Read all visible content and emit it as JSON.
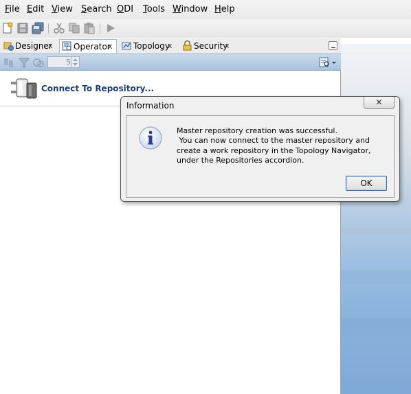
{
  "menu": {
    "items": [
      {
        "mnemonic": "F",
        "rest": "ile"
      },
      {
        "mnemonic": "E",
        "rest": "dit"
      },
      {
        "mnemonic": "V",
        "rest": "iew"
      },
      {
        "mnemonic": "S",
        "rest": "earch"
      },
      {
        "mnemonic": "O",
        "rest": "DI"
      },
      {
        "mnemonic": "T",
        "rest": "ools"
      },
      {
        "mnemonic": "W",
        "rest": "indow"
      },
      {
        "mnemonic": "H",
        "rest": "elp"
      }
    ]
  },
  "navigator_tabs": [
    {
      "label": "Designer",
      "icon": "designer-icon",
      "close": "x"
    },
    {
      "label": "Operator",
      "icon": "operator-icon",
      "close": "x",
      "active": true
    },
    {
      "label": "Topology",
      "icon": "topology-icon",
      "close": "x"
    },
    {
      "label": "Security",
      "icon": "security-icon",
      "close": "x"
    }
  ],
  "panel_toolbar": {
    "spinner_value": "5"
  },
  "panel": {
    "connect_label": "Connect To Repository..."
  },
  "dialog": {
    "title": "Information",
    "close_glyph": "✕",
    "message": "Master repository creation was successful.\n You can now connect to the master repository and create a work repository in the Topology Navigator, under the Repositories accordion.",
    "ok_label": "OK"
  },
  "colors": {
    "accent": "#1a3d7c",
    "toolbar_blue": "#b9cee6",
    "dialog_bg": "#f0f0f0"
  }
}
